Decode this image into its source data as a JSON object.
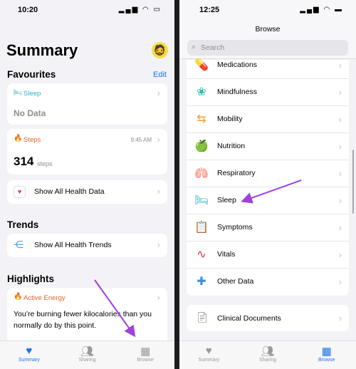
{
  "left": {
    "time": "10:20",
    "title": "Summary",
    "favourites": {
      "heading": "Favourites",
      "edit": "Edit"
    },
    "sleep_card": {
      "label": "Sleep",
      "value": "No Data",
      "color": "#30b0c7"
    },
    "steps_card": {
      "label": "Steps",
      "time": "9:45 AM",
      "value": "314",
      "unit": "steps",
      "color": "#e8622c"
    },
    "show_all_data": "Show All Health Data",
    "trends": {
      "heading": "Trends",
      "show_all": "Show All Health Trends"
    },
    "highlights": {
      "heading": "Highlights",
      "label": "Active Energy",
      "text": "You’re burning fewer kilocalories than you normally do by this point."
    },
    "tabs": [
      {
        "label": "Summary",
        "icon": "heart-icon",
        "active": true
      },
      {
        "label": "Sharing",
        "icon": "people-icon"
      },
      {
        "label": "Browse",
        "icon": "grid-icon"
      }
    ]
  },
  "right": {
    "time": "12:25",
    "title": "Browse",
    "search_placeholder": "Search",
    "categories": [
      {
        "label": "Medications",
        "icon": "pill-icon",
        "glyph": "💊",
        "color": "#3aa0e0"
      },
      {
        "label": "Mindfulness",
        "icon": "flower-icon",
        "glyph": "❀",
        "color": "#2fbfa8"
      },
      {
        "label": "Mobility",
        "icon": "arrows-icon",
        "glyph": "⇆",
        "color": "#f0a030"
      },
      {
        "label": "Nutrition",
        "icon": "apple-icon",
        "glyph": "🍏",
        "color": "#4caf50"
      },
      {
        "label": "Respiratory",
        "icon": "lungs-icon",
        "glyph": "🫁",
        "color": "#3a8ee0"
      },
      {
        "label": "Sleep",
        "icon": "bed-icon",
        "glyph": "🛏",
        "color": "#30b0c7"
      },
      {
        "label": "Symptoms",
        "icon": "clipboard-icon",
        "glyph": "📋",
        "color": "#4050c0"
      },
      {
        "label": "Vitals",
        "icon": "pulse-icon",
        "glyph": "∿",
        "color": "#e03040"
      },
      {
        "label": "Other Data",
        "icon": "plus-icon",
        "glyph": "✚",
        "color": "#3a8ee0"
      }
    ],
    "clinical": "Clinical Documents",
    "tabs": [
      {
        "label": "Summary",
        "icon": "heart-icon"
      },
      {
        "label": "Sharing",
        "icon": "people-icon"
      },
      {
        "label": "Browse",
        "icon": "grid-icon",
        "active": true
      }
    ]
  },
  "annotation_color": "#a040e0"
}
